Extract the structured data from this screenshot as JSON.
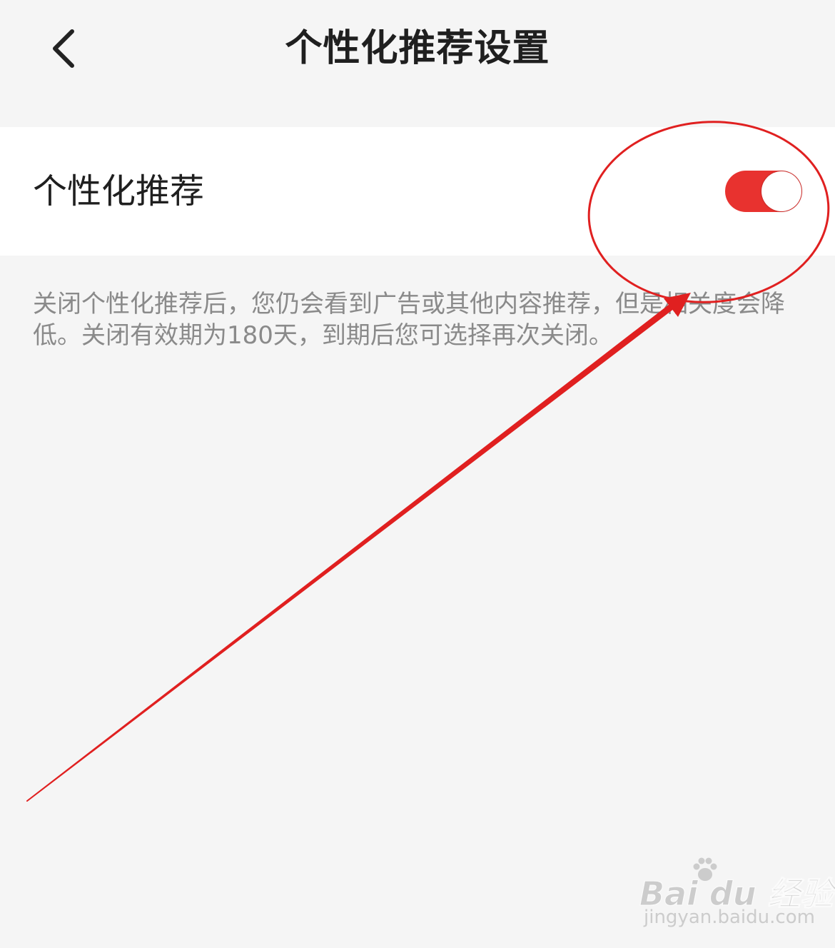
{
  "header": {
    "back_icon": "chevron-left-icon",
    "title": "个性化推荐设置"
  },
  "setting": {
    "label": "个性化推荐",
    "toggle_state": "on",
    "toggle_color": "#e8322f"
  },
  "description": "关闭个性化推荐后，您仍会看到广告或其他内容推荐，但是相关度会降低。关闭有效期为180天，到期后您可选择再次关闭。",
  "annotation": {
    "color": "#e02020",
    "shapes": [
      "ellipse",
      "arrow"
    ]
  },
  "watermark": {
    "brand": "Bai du 经验",
    "url": "jingyan.baidu.com"
  }
}
